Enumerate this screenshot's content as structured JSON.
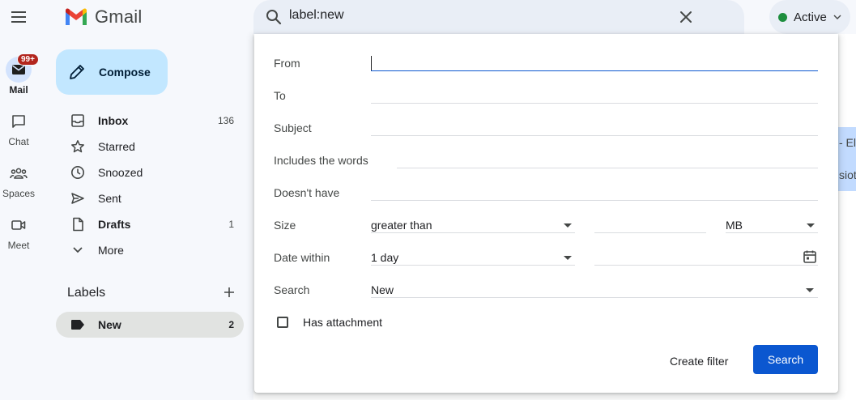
{
  "app": {
    "name": "Gmail"
  },
  "search": {
    "query": "label:new"
  },
  "status": {
    "label": "Active",
    "color": "#1e8e3e"
  },
  "rail": {
    "items": [
      {
        "label": "Mail",
        "icon": "mail-icon",
        "badge": "99+"
      },
      {
        "label": "Chat",
        "icon": "chat-icon"
      },
      {
        "label": "Spaces",
        "icon": "spaces-icon"
      },
      {
        "label": "Meet",
        "icon": "meet-icon"
      }
    ]
  },
  "compose": {
    "label": "Compose"
  },
  "nav": {
    "items": [
      {
        "label": "Inbox",
        "count": "136",
        "icon": "inbox-icon"
      },
      {
        "label": "Starred",
        "icon": "star-icon"
      },
      {
        "label": "Snoozed",
        "icon": "clock-icon"
      },
      {
        "label": "Sent",
        "icon": "send-icon"
      },
      {
        "label": "Drafts",
        "count": "1",
        "icon": "draft-icon"
      },
      {
        "label": "More",
        "icon": "chevron-down-icon"
      }
    ]
  },
  "labels": {
    "heading": "Labels",
    "items": [
      {
        "label": "New",
        "count": "2",
        "icon": "label-icon"
      }
    ]
  },
  "background": {
    "snippet1": "- El",
    "snippet2": "sioti"
  },
  "advanced_search": {
    "from_label": "From",
    "from_value": "",
    "to_label": "To",
    "subject_label": "Subject",
    "includes_label": "Includes the words",
    "doesnt_have_label": "Doesn't have",
    "size_label": "Size",
    "size_operator": "greater than",
    "size_unit": "MB",
    "date_label": "Date within",
    "date_value": "1 day",
    "search_label": "Search",
    "search_scope": "New",
    "attachment_label": "Has attachment",
    "create_filter_label": "Create filter",
    "search_button_label": "Search"
  },
  "colors": {
    "accent": "#0b57d0",
    "compose_bg": "#c2e7ff",
    "badge": "#b3261e"
  }
}
